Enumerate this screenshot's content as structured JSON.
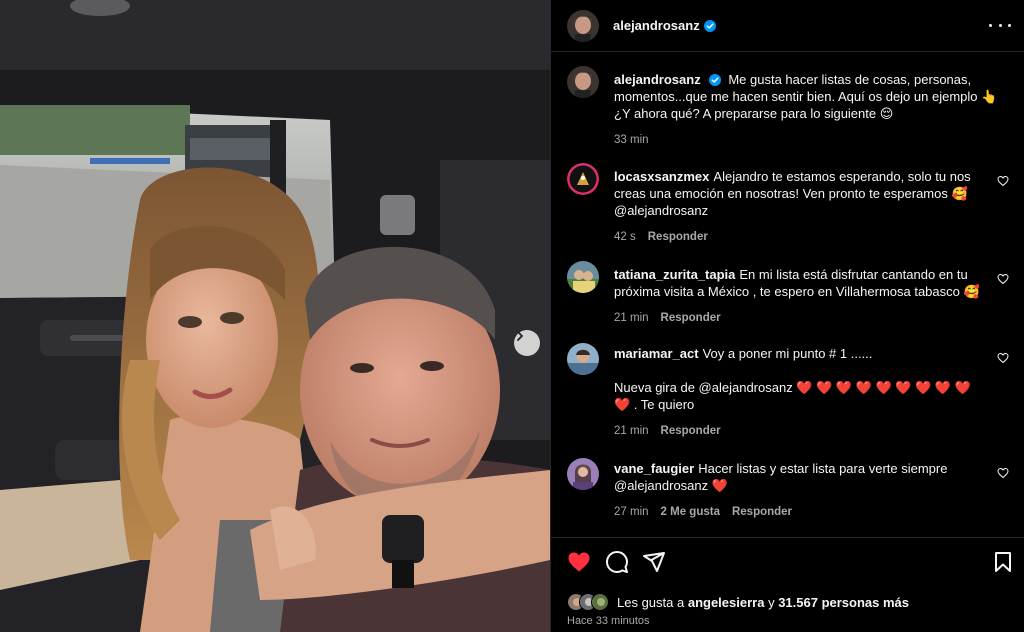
{
  "post": {
    "author": "alejandrosanz",
    "caption_text": "Me gusta hacer listas de cosas, personas, momentos...que me hacen sentir bien. Aquí os dejo un ejemplo 👆¿Y ahora qué? A prepararse para lo siguiente 😌",
    "caption_time": "33 min",
    "likes_prefix": "Les gusta a",
    "likes_user": "angelesierra",
    "likes_joiner": "y",
    "likes_count": "31.567 personas más",
    "posted_ago": "Hace 33 minutos"
  },
  "comments": [
    {
      "user": "locasxsanzmex",
      "text": "Alejandro te estamos esperando, solo tu nos creas una emoción en nosotras! Ven pronto te esperamos 🥰 @alejandrosanz",
      "time": "42 s",
      "reply": "Responder"
    },
    {
      "user": "tatiana_zurita_tapia",
      "text": "En mi lista está disfrutar cantando en tu próxima visita a México , te espero en Villahermosa tabasco 🥰",
      "time": "21 min",
      "reply": "Responder"
    },
    {
      "user": "mariamar_act",
      "text": "Voy a poner mi punto # 1 ......",
      "text2": "Nueva gira de @alejandrosanz ❤️ ❤️ ❤️ ❤️ ❤️ ❤️ ❤️ ❤️ ❤️ ❤️ . Te quiero",
      "time": "21 min",
      "reply": "Responder"
    },
    {
      "user": "vane_faugier",
      "text": "Hacer listas y estar lista para verte siempre @alejandrosanz ❤️",
      "time": "27 min",
      "likes": "2 Me gusta",
      "reply": "Responder"
    }
  ],
  "icons": {
    "like": "heart-filled-icon",
    "comment": "comment-icon",
    "share": "send-icon",
    "save": "bookmark-icon",
    "more": "more-options-icon",
    "verified": "verified-badge-icon",
    "next": "chevron-right-icon"
  },
  "colors": {
    "background": "#000000",
    "text": "#f5f5f5",
    "muted": "#a8a8a8",
    "like_red": "#ff3040",
    "verified_blue": "#0095f6",
    "divider": "#262626"
  }
}
